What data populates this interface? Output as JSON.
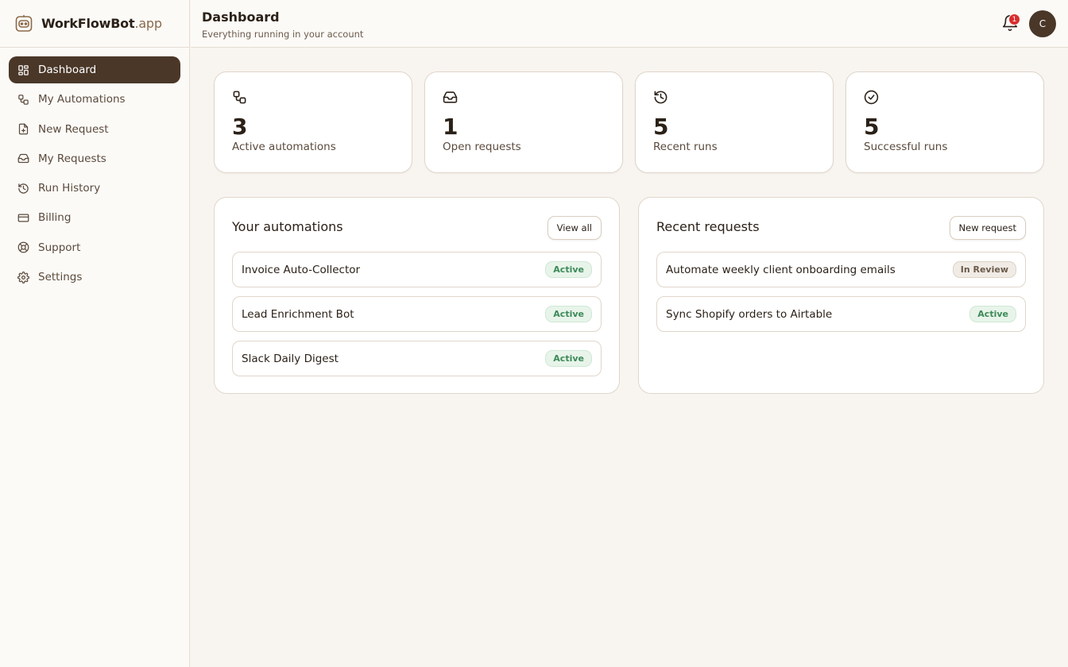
{
  "brand": {
    "name": "WorkFlowBot",
    "tld": ".app"
  },
  "sidebar": {
    "items": [
      {
        "label": "Dashboard",
        "icon": "grid-icon",
        "active": true
      },
      {
        "label": "My Automations",
        "icon": "workflow-icon"
      },
      {
        "label": "New Request",
        "icon": "file-plus-icon"
      },
      {
        "label": "My Requests",
        "icon": "inbox-icon"
      },
      {
        "label": "Run History",
        "icon": "history-icon"
      },
      {
        "label": "Billing",
        "icon": "credit-card-icon"
      },
      {
        "label": "Support",
        "icon": "lifebuoy-icon"
      },
      {
        "label": "Settings",
        "icon": "gear-icon"
      }
    ]
  },
  "header": {
    "title": "Dashboard",
    "subtitle": "Everything running in your account",
    "notifications_count": "1",
    "avatar_initial": "C"
  },
  "stats": [
    {
      "value": "3",
      "label": "Active automations",
      "icon": "workflow-icon"
    },
    {
      "value": "1",
      "label": "Open requests",
      "icon": "inbox-icon"
    },
    {
      "value": "5",
      "label": "Recent runs",
      "icon": "history-icon"
    },
    {
      "value": "5",
      "label": "Successful runs",
      "icon": "check-circle-icon"
    }
  ],
  "automations": {
    "title": "Your automations",
    "button": "View all",
    "items": [
      {
        "name": "Invoice Auto-Collector",
        "status": "Active"
      },
      {
        "name": "Lead Enrichment Bot",
        "status": "Active"
      },
      {
        "name": "Slack Daily Digest",
        "status": "Active"
      }
    ]
  },
  "requests": {
    "title": "Recent requests",
    "button": "New request",
    "items": [
      {
        "name": "Automate weekly client onboarding emails",
        "status": "In Review"
      },
      {
        "name": "Sync Shopify orders to Airtable",
        "status": "Active"
      }
    ]
  },
  "colors": {
    "accent": "#4a3728",
    "active_badge": "#3d8a58",
    "notification": "#d92c2c"
  }
}
